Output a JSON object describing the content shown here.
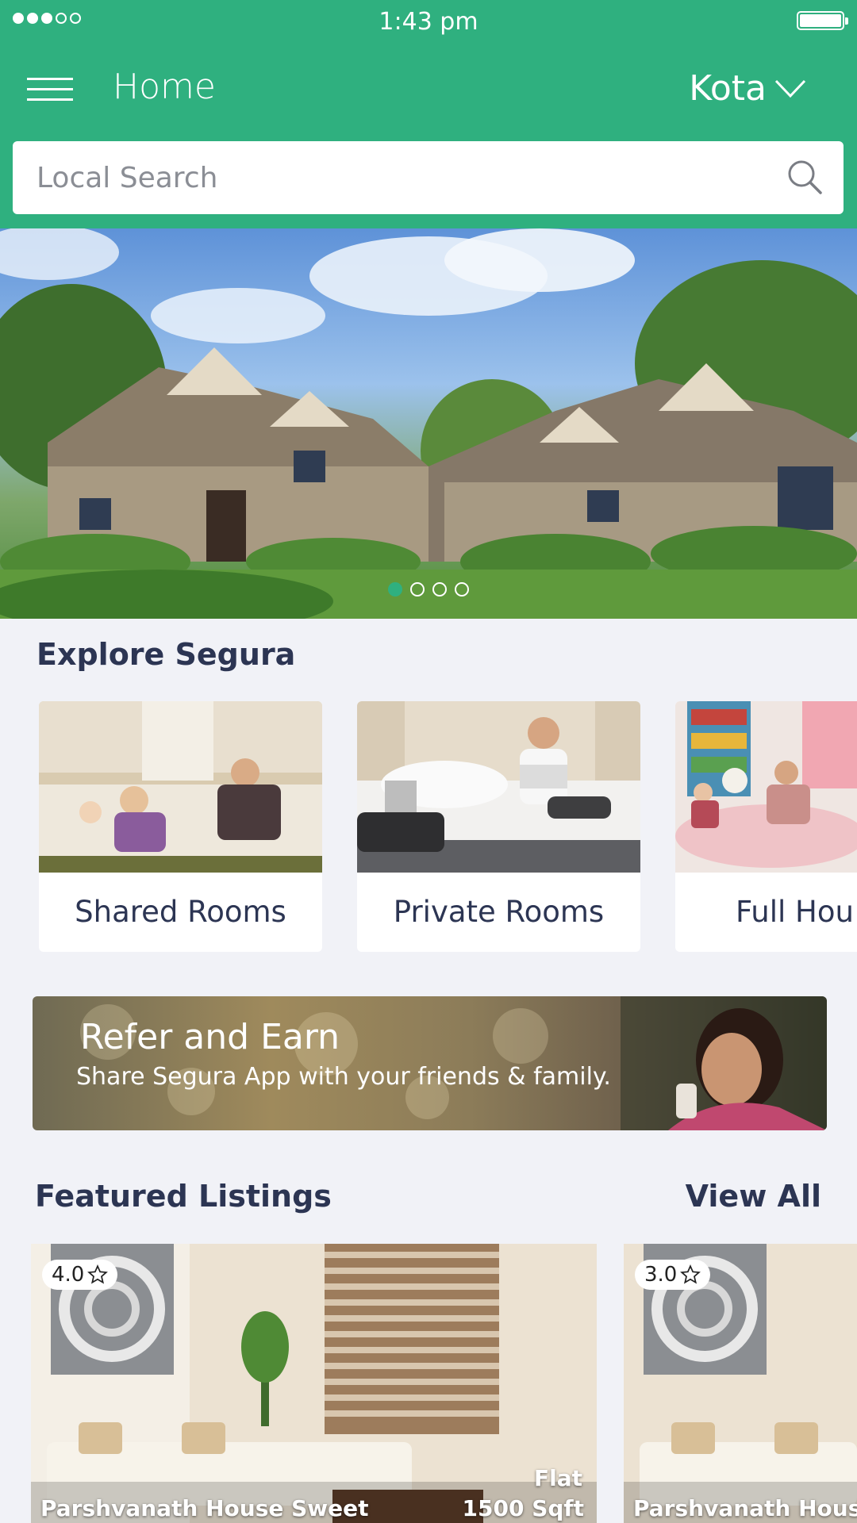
{
  "status_bar": {
    "time": "1:43 pm",
    "signal_filled": 3,
    "signal_total": 5,
    "battery_level": 1.0
  },
  "header": {
    "title": "Home",
    "city": "Kota",
    "menu_icon": "hamburger-menu-icon",
    "dropdown_icon": "chevron-down-icon",
    "background": "#2fb07f"
  },
  "search": {
    "placeholder": "Local Search",
    "value": "",
    "icon": "search-icon"
  },
  "hero": {
    "pager": {
      "total": 4,
      "active_index": 0
    }
  },
  "explore": {
    "title": "Explore Segura",
    "categories": [
      {
        "label": "Shared Rooms"
      },
      {
        "label": "Private Rooms"
      },
      {
        "label": "Full Hou"
      }
    ]
  },
  "refer": {
    "title": "Refer and Earn",
    "subtitle": "Share Segura App with your friends & family."
  },
  "featured": {
    "title": "Featured Listings",
    "view_all": "View All",
    "listings": [
      {
        "rating": "4.0",
        "name": "Parshvanath House Sweet",
        "type": "Flat",
        "size": "1500 Sqft"
      },
      {
        "rating": "3.0",
        "name": "Parshvanath House"
      }
    ]
  },
  "colors": {
    "accent": "#2fb07f",
    "heading": "#2c3553",
    "background": "#f1f2f7"
  }
}
